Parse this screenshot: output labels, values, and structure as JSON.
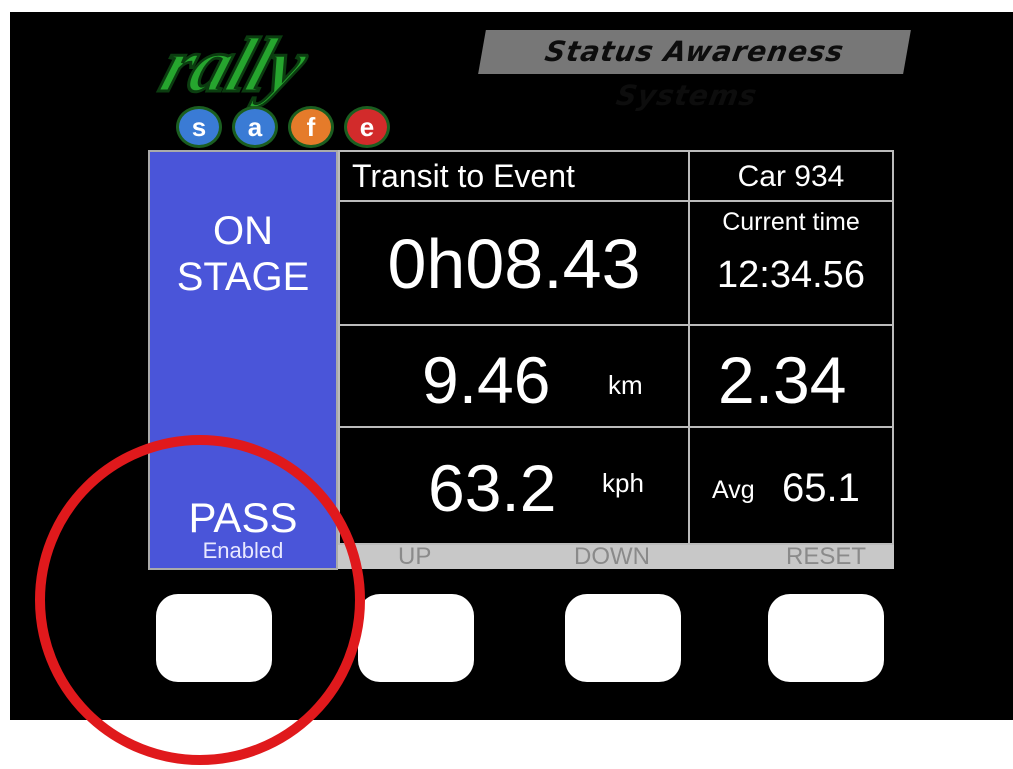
{
  "branding": {
    "logo_word": "rally",
    "logo_letters": [
      "s",
      "a",
      "f",
      "e"
    ],
    "logo_letter_colors": [
      "#3a7bd5",
      "#3a7bd5",
      "#e57b2a",
      "#d22b2b"
    ],
    "tagline": "Status Awareness Systems"
  },
  "status": {
    "line1": "ON",
    "line2": "STAGE",
    "pass": "PASS",
    "pass_state": "Enabled",
    "panel_color": "#4a55d9"
  },
  "display": {
    "title": "Transit to Event",
    "car": "Car 934",
    "timer": "0h08.43",
    "clock_label": "Current time",
    "clock": "12:34.56",
    "distance": "9.46",
    "distance_unit": "km",
    "value_right": "2.34",
    "speed": "63.2",
    "speed_unit": "kph",
    "avg_label": "Avg",
    "avg_value": "65.1"
  },
  "softkeys": {
    "up": "UP",
    "down": "DOWN",
    "reset": "RESET"
  },
  "annotation": {
    "highlight_color": "#e0191c"
  }
}
